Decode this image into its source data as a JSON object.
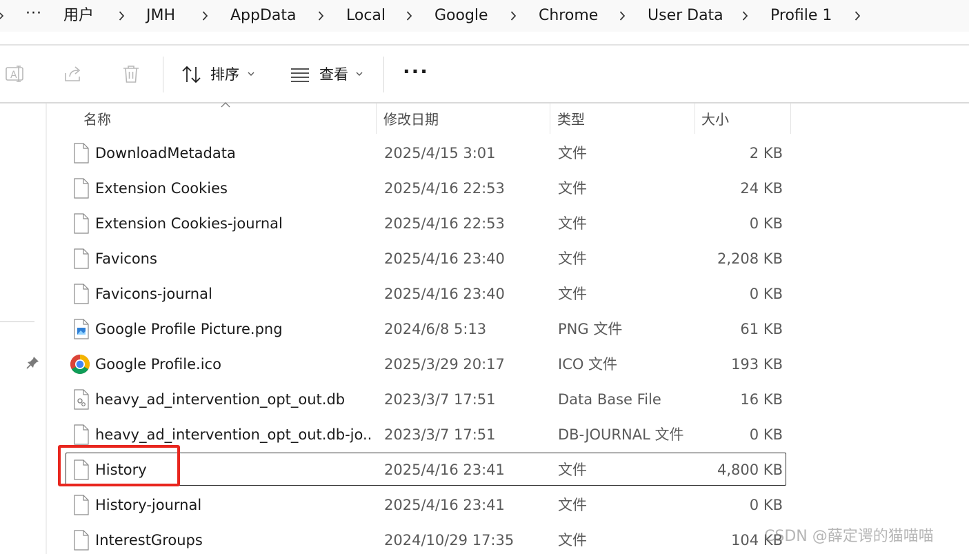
{
  "breadcrumb": {
    "more": "···",
    "items": [
      "用户",
      "JMH",
      "AppData",
      "Local",
      "Google",
      "Chrome",
      "User Data",
      "Profile 1"
    ]
  },
  "toolbar": {
    "sort_label": "排序",
    "view_label": "查看",
    "more_label": "···"
  },
  "columns": {
    "name": "名称",
    "date": "修改日期",
    "type": "类型",
    "size": "大小"
  },
  "files": [
    {
      "name": "DownloadMetadata",
      "date": "2025/4/15 3:01",
      "type": "文件",
      "size": "2 KB",
      "icon": "file-icon"
    },
    {
      "name": "Extension Cookies",
      "date": "2025/4/16 22:53",
      "type": "文件",
      "size": "24 KB",
      "icon": "file-icon"
    },
    {
      "name": "Extension Cookies-journal",
      "date": "2025/4/16 22:53",
      "type": "文件",
      "size": "0 KB",
      "icon": "file-icon"
    },
    {
      "name": "Favicons",
      "date": "2025/4/16 23:40",
      "type": "文件",
      "size": "2,208 KB",
      "icon": "file-icon"
    },
    {
      "name": "Favicons-journal",
      "date": "2025/4/16 23:40",
      "type": "文件",
      "size": "0 KB",
      "icon": "file-icon"
    },
    {
      "name": "Google Profile Picture.png",
      "date": "2024/6/8 5:13",
      "type": "PNG 文件",
      "size": "61 KB",
      "icon": "image-file-icon"
    },
    {
      "name": "Google Profile.ico",
      "date": "2025/3/29 20:17",
      "type": "ICO 文件",
      "size": "193 KB",
      "icon": "chrome-icon"
    },
    {
      "name": "heavy_ad_intervention_opt_out.db",
      "date": "2023/3/7 17:51",
      "type": "Data Base File",
      "size": "16 KB",
      "icon": "database-file-icon"
    },
    {
      "name": "heavy_ad_intervention_opt_out.db-jo...",
      "date": "2023/3/7 17:51",
      "type": "DB-JOURNAL 文件",
      "size": "0 KB",
      "icon": "file-icon"
    },
    {
      "name": "History",
      "date": "2025/4/16 23:41",
      "type": "文件",
      "size": "4,800 KB",
      "icon": "file-icon",
      "selected": true
    },
    {
      "name": "History-journal",
      "date": "2025/4/16 23:41",
      "type": "文件",
      "size": "0 KB",
      "icon": "file-icon"
    },
    {
      "name": "InterestGroups",
      "date": "2024/10/29 17:35",
      "type": "文件",
      "size": "104 KB",
      "icon": "file-icon"
    }
  ],
  "highlight_color": "#e8261e",
  "watermark": "CSDN @薛定谔的猫喵喵"
}
